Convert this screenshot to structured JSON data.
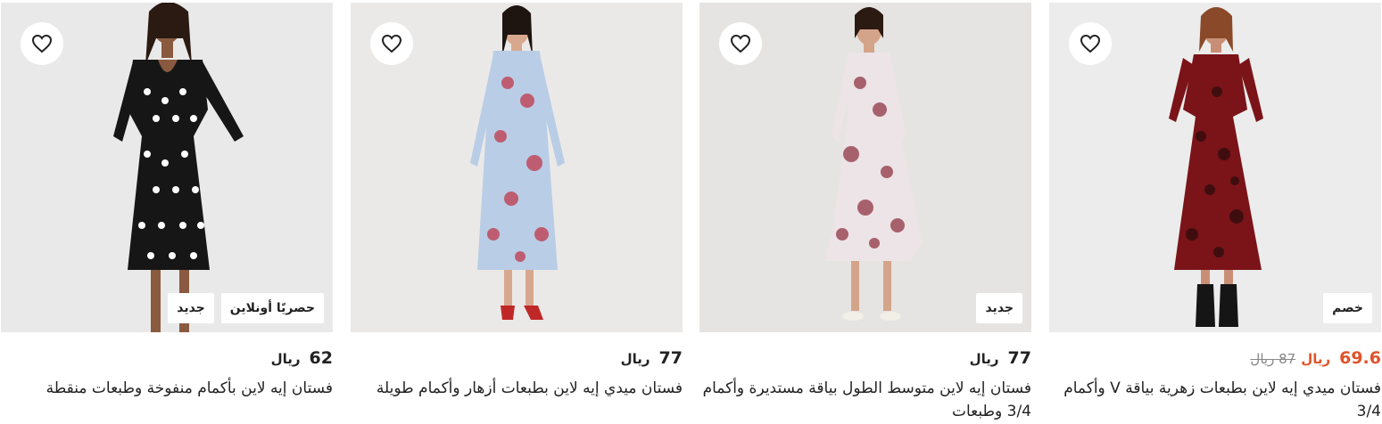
{
  "products": [
    {
      "price": "69.6",
      "currency": "ريال",
      "old_price": "87",
      "old_currency": "ريال",
      "title": "فستان ميدي إيه لاين بطبعات زهرية بياقة V وأكمام 3/4",
      "badges": [
        "خصم"
      ],
      "dress_color": "#7a1418",
      "pattern_color": "#1a0a0a",
      "sale": true
    },
    {
      "price": "77",
      "currency": "ريال",
      "title": "فستان إيه لاين متوسط الطول بياقة مستديرة وأكمام 3/4 وطبعات",
      "badges": [
        "جديد"
      ],
      "dress_color": "#ece4e6",
      "pattern_color": "#8a2a3a",
      "sale": false
    },
    {
      "price": "77",
      "currency": "ريال",
      "title": "فستان ميدي إيه لاين بطبعات أزهار وأكمام طويلة",
      "badges": [],
      "dress_color": "#b9cde6",
      "pattern_color": "#c0384a",
      "sale": false
    },
    {
      "price": "62",
      "currency": "ريال",
      "title": "فستان إيه لاين بأكمام منفوخة وطبعات منقطة",
      "badges": [
        "حصريًا أونلاين",
        "جديد"
      ],
      "dress_color": "#161616",
      "pattern_color": "#ffffff",
      "sale": false
    }
  ]
}
